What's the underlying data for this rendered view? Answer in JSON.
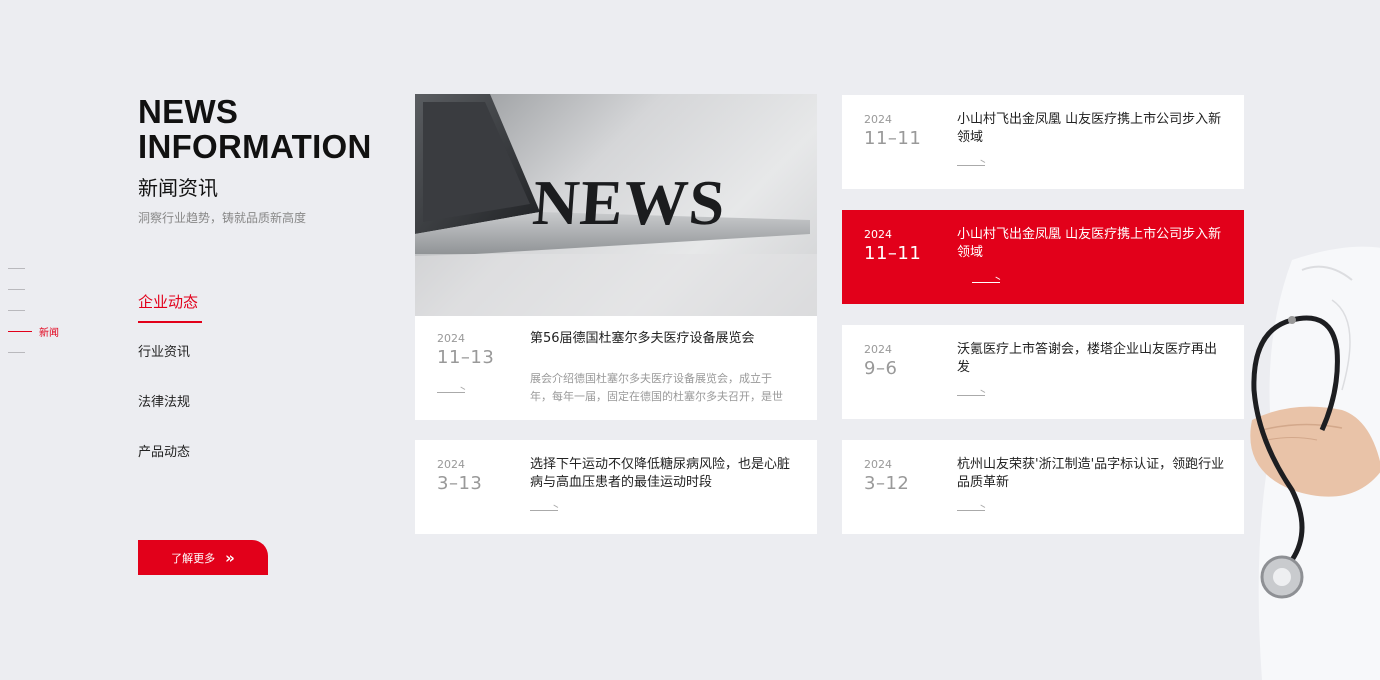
{
  "pager": {
    "active_label": "新闻"
  },
  "heading": {
    "en_line1": "NEWS",
    "en_line2": "INFORMATION",
    "cn": "新闻资讯",
    "sub": "洞察行业趋势，铸就品质新高度"
  },
  "categories": [
    "企业动态",
    "行业资讯",
    "法律法规",
    "产品动态"
  ],
  "more_button": {
    "label": "了解更多",
    "icon": "double-chevron-right-icon"
  },
  "feature": {
    "image_text": "NEWS",
    "year": "2024",
    "md": "11–13",
    "title": "第56届德国杜塞尔多夫医疗设备展览会",
    "summary": "展会介绍德国杜塞尔多夫医疗设备展览会，成立于年，每年一届，固定在德国的杜塞尔多夫召开，是世界知..."
  },
  "news": [
    {
      "year": "2024",
      "md": "3–13",
      "title": "选择下午运动不仅降低糖尿病风险，也是心脏病与高血压患者的最佳运动时段"
    },
    {
      "year": "2024",
      "md": "11–11",
      "title": "小山村飞出金凤凰 山友医疗携上市公司步入新领域"
    },
    {
      "year": "2024",
      "md": "11–11",
      "title": "小山村飞出金凤凰 山友医疗携上市公司步入新领域"
    },
    {
      "year": "2024",
      "md": "9–6",
      "title": "沃氪医疗上市答谢会，楼塔企业山友医疗再出发"
    },
    {
      "year": "2024",
      "md": "3–12",
      "title": "杭州山友荣获'浙江制造'品字标认证，领跑行业品质革新"
    }
  ],
  "colors": {
    "accent": "#e2001a",
    "background": "#ecedf1"
  }
}
